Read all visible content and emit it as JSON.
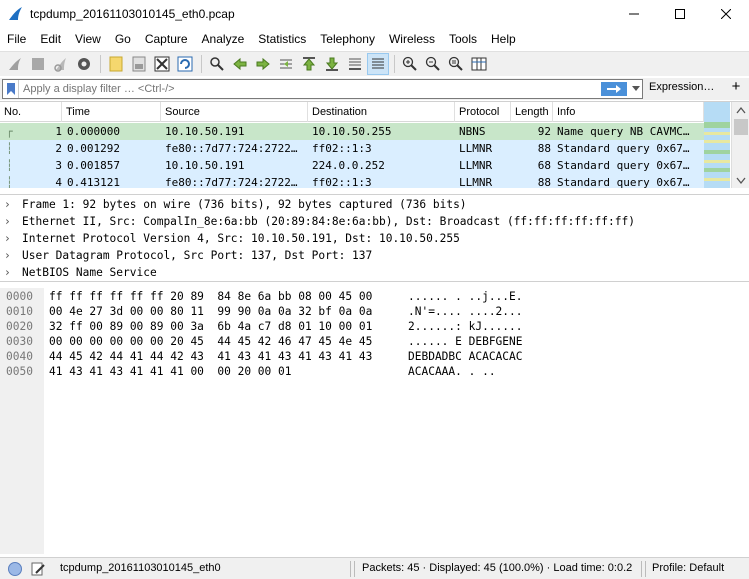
{
  "window": {
    "title": "tcpdump_20161103010145_eth0.pcap"
  },
  "menu": [
    "File",
    "Edit",
    "View",
    "Go",
    "Capture",
    "Analyze",
    "Statistics",
    "Telephony",
    "Wireless",
    "Tools",
    "Help"
  ],
  "filter": {
    "placeholder": "Apply a display filter … <Ctrl-/>",
    "expression_label": "Expression…",
    "plus_label": "+"
  },
  "packet_list": {
    "columns": [
      "No.",
      "Time",
      "Source",
      "Destination",
      "Protocol",
      "Length",
      "Info"
    ],
    "rows": [
      {
        "no": "1",
        "time": "0.000000",
        "src": "10.10.50.191",
        "dst": "10.10.50.255",
        "proto": "NBNS",
        "len": "92",
        "info": "Name query NB CAVMC…"
      },
      {
        "no": "2",
        "time": "0.001292",
        "src": "fe80::7d77:724:2722…",
        "dst": "ff02::1:3",
        "proto": "LLMNR",
        "len": "88",
        "info": "Standard query 0x67…"
      },
      {
        "no": "3",
        "time": "0.001857",
        "src": "10.10.50.191",
        "dst": "224.0.0.252",
        "proto": "LLMNR",
        "len": "68",
        "info": "Standard query 0x67…"
      },
      {
        "no": "4",
        "time": "0.413121",
        "src": "fe80::7d77:724:2722…",
        "dst": "ff02::1:3",
        "proto": "LLMNR",
        "len": "88",
        "info": "Standard query 0x67…"
      }
    ]
  },
  "details": [
    "Frame 1: 92 bytes on wire (736 bits), 92 bytes captured (736 bits)",
    "Ethernet II, Src: CompalIn_8e:6a:bb (20:89:84:8e:6a:bb), Dst: Broadcast (ff:ff:ff:ff:ff:ff)",
    "Internet Protocol Version 4, Src: 10.10.50.191, Dst: 10.10.50.255",
    "User Datagram Protocol, Src Port: 137, Dst Port: 137",
    "NetBIOS Name Service"
  ],
  "bytes": [
    {
      "offset": "0000",
      "hex": "ff ff ff ff ff ff 20 89  84 8e 6a bb 08 00 45 00",
      "ascii": "...... . ..j...E."
    },
    {
      "offset": "0010",
      "hex": "00 4e 27 3d 00 00 80 11  99 90 0a 0a 32 bf 0a 0a",
      "ascii": ".N'=.... ....2..."
    },
    {
      "offset": "0020",
      "hex": "32 ff 00 89 00 89 00 3a  6b 4a c7 d8 01 10 00 01",
      "ascii": "2......: kJ......"
    },
    {
      "offset": "0030",
      "hex": "00 00 00 00 00 00 20 45  44 45 42 46 47 45 4e 45",
      "ascii": "...... E DEBFGENE"
    },
    {
      "offset": "0040",
      "hex": "44 45 42 44 41 44 42 43  41 43 41 43 41 43 41 43",
      "ascii": "DEBDADBC ACACACAC"
    },
    {
      "offset": "0050",
      "hex": "41 43 41 43 41 41 41 00  00 20 00 01",
      "ascii": "ACACAAA. . .."
    }
  ],
  "status": {
    "file": "tcpdump_20161103010145_eth0",
    "packets": "Packets: 45 · Displayed: 45 (100.0%) · Load time: 0:0.2",
    "profile": "Profile: Default"
  },
  "colors": {
    "row_selected_green": "#c8e6c9",
    "row_llmnr_blue": "#daeeff",
    "accent_blue": "#4a90d9"
  }
}
